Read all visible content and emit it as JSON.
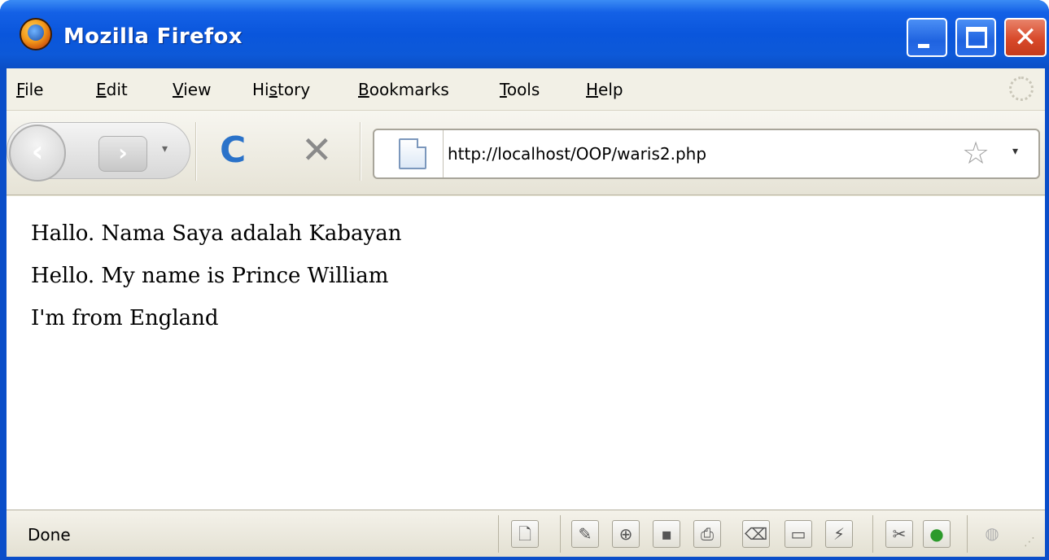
{
  "window": {
    "title": "Mozilla Firefox",
    "minimize_glyph": "",
    "maximize_glyph": "",
    "close_glyph": "✕"
  },
  "menu": {
    "items": [
      {
        "pre": "",
        "u": "F",
        "post": "ile"
      },
      {
        "pre": "",
        "u": "E",
        "post": "dit"
      },
      {
        "pre": "",
        "u": "V",
        "post": "iew"
      },
      {
        "pre": "Hi",
        "u": "s",
        "post": "tory"
      },
      {
        "pre": "",
        "u": "B",
        "post": "ookmarks"
      },
      {
        "pre": "",
        "u": "T",
        "post": "ools"
      },
      {
        "pre": "",
        "u": "H",
        "post": "elp"
      }
    ]
  },
  "toolbar": {
    "back_glyph": "‹",
    "forward_glyph": "›",
    "history_dropdown_glyph": "▾",
    "reload_glyph": "C",
    "stop_glyph": "✕",
    "url": "http://localhost/OOP/waris2.php",
    "bookmark_star_glyph": "☆",
    "url_dropdown_glyph": "▾"
  },
  "page": {
    "lines": [
      "Hallo. Nama Saya adalah Kabayan",
      "Hello. My name is Prince William",
      "I'm from England"
    ]
  },
  "status": {
    "text": "Done",
    "icons": [
      {
        "name": "page-info-icon",
        "glyph": "🗋"
      },
      {
        "name": "edit-icon",
        "glyph": "✎"
      },
      {
        "name": "network-icon",
        "glyph": "⊕"
      },
      {
        "name": "save-icon",
        "glyph": "▪"
      },
      {
        "name": "print-icon",
        "glyph": "⎙"
      },
      {
        "name": "erase-icon",
        "glyph": "⌫"
      },
      {
        "name": "window-icon",
        "glyph": "▭"
      },
      {
        "name": "graph-icon",
        "glyph": "⚡"
      },
      {
        "name": "tools-icon",
        "glyph": "✂"
      },
      {
        "name": "info-icon",
        "glyph": "●"
      },
      {
        "name": "js-icon",
        "glyph": "◍"
      }
    ]
  }
}
